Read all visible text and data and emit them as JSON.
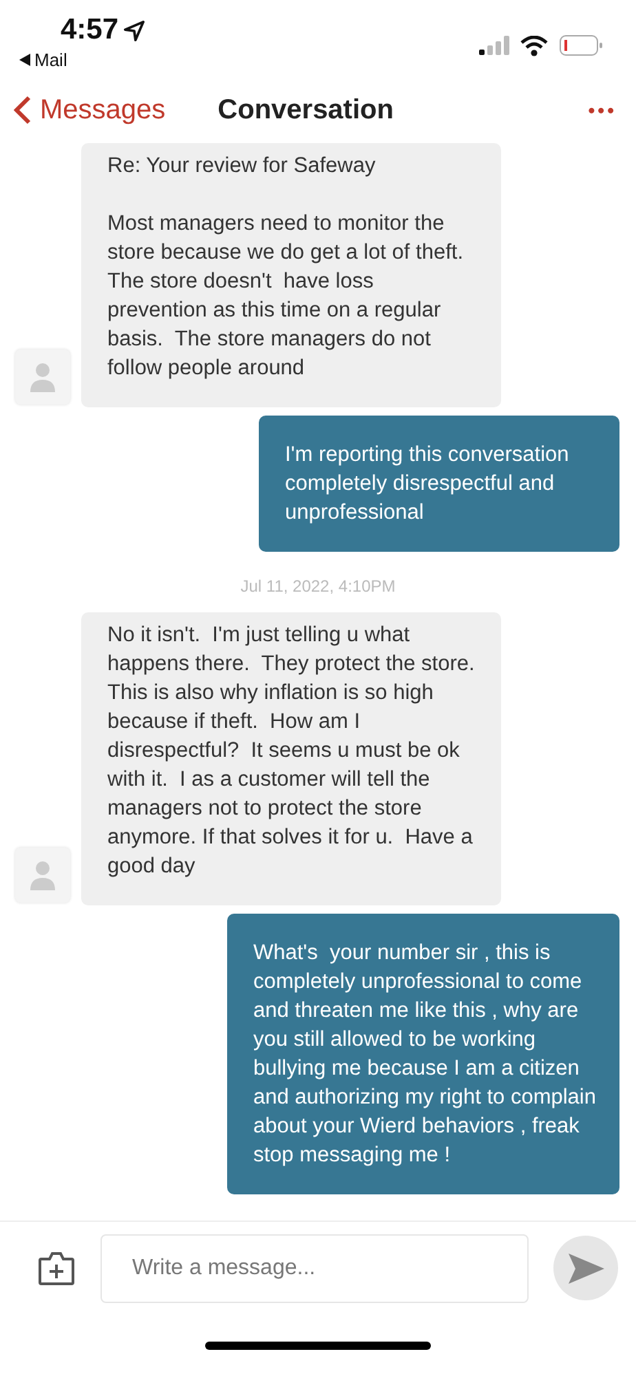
{
  "status_bar": {
    "time": "4:57",
    "back_app": "Mail"
  },
  "nav": {
    "back": "Messages",
    "title": "Conversation",
    "more": "•••"
  },
  "messages": [
    {
      "kind": "incoming",
      "text": "Re: Your review for Safeway\n\nMost managers need to monitor the store because we do get a lot of theft. The store doesn't  have loss prevention as this time on a regular basis.  The store managers do not follow people around"
    },
    {
      "kind": "outgoing",
      "text": "I'm reporting this conversation completely disrespectful and unprofessional"
    },
    {
      "kind": "timestamp",
      "text": "Jul 11, 2022, 4:10PM"
    },
    {
      "kind": "incoming",
      "text": "No it isn't.  I'm just telling u what happens there.  They protect the store.  This is also why inflation is so high because if theft.  How am I disrespectful?  It seems u must be ok with it.  I as a customer will tell the managers not to protect the store anymore. If that solves it for u.  Have a good day"
    },
    {
      "kind": "outgoing",
      "text": "What's  your number sir , this is completely unprofessional to come and threaten me like this , why are you still allowed to be working bullying me because I am a citizen and authorizing my right to complain about your Wierd behaviors , freak stop messaging me !"
    }
  ],
  "composer": {
    "placeholder": "Write a message..."
  }
}
